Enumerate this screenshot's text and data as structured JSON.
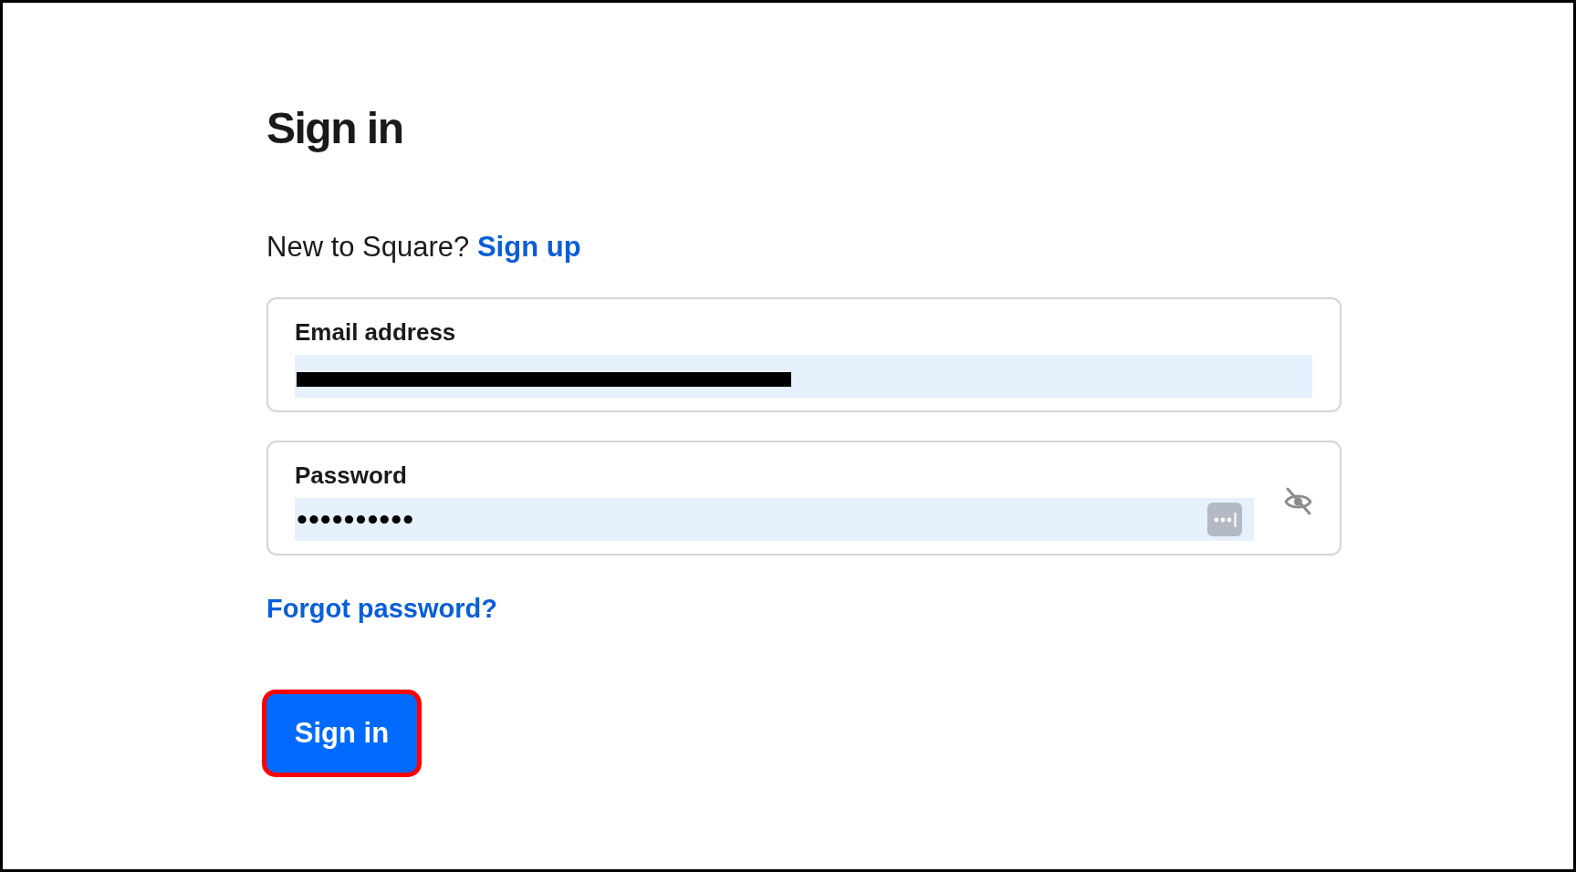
{
  "page_title": "Sign in",
  "signup_prompt": {
    "text": "New to Square?",
    "link": "Sign up"
  },
  "fields": [
    {
      "kind": "email",
      "label": "Email address",
      "autofilled": true,
      "value_redacted": true
    },
    {
      "kind": "password",
      "label": "Password",
      "value": "••••••••••",
      "autofilled": true,
      "masked": true
    }
  ],
  "forgot_password_link": "Forgot password?",
  "submit_button": {
    "label": "Sign in",
    "highlighted": true
  }
}
